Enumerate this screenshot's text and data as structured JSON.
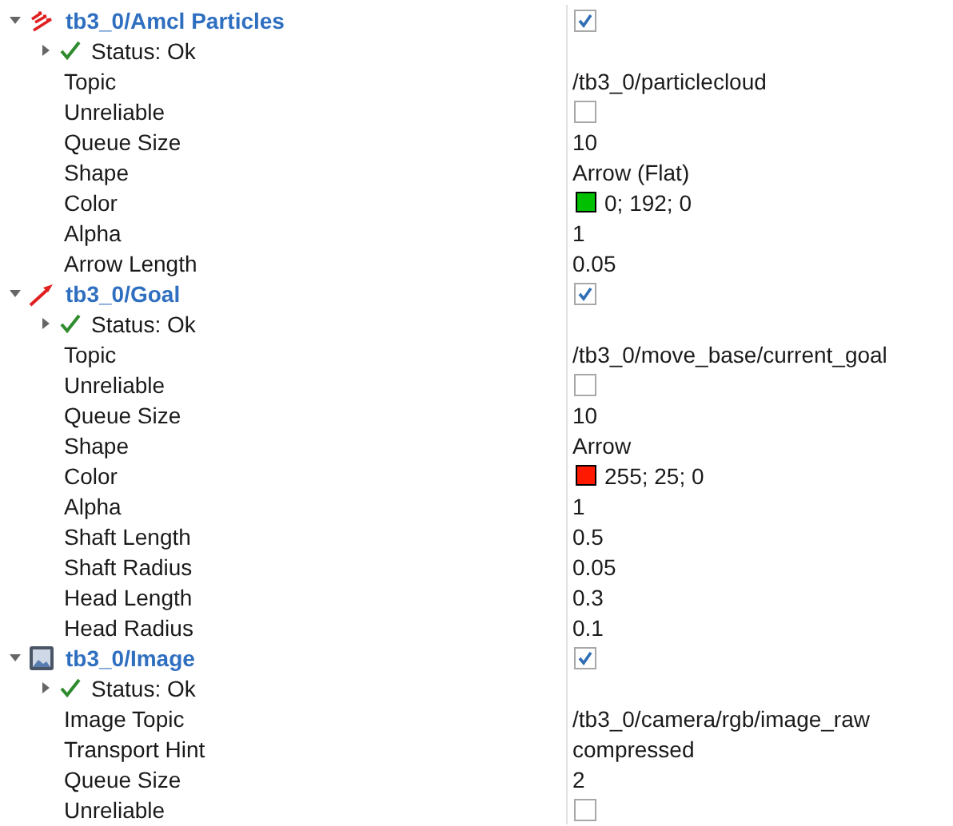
{
  "displays": [
    {
      "name": "tb3_0/Amcl Particles",
      "kind": "particles",
      "expanded": true,
      "enabled": true,
      "status": {
        "text": "Status: Ok",
        "expanded": false
      },
      "properties": [
        {
          "label": "Topic",
          "kind": "text",
          "value": "/tb3_0/particlecloud"
        },
        {
          "label": "Unreliable",
          "kind": "checkbox",
          "checked": false
        },
        {
          "label": "Queue Size",
          "kind": "text",
          "value": "10"
        },
        {
          "label": "Shape",
          "kind": "text",
          "value": "Arrow (Flat)"
        },
        {
          "label": "Color",
          "kind": "color",
          "value": "0; 192; 0",
          "color": "#00c000"
        },
        {
          "label": "Alpha",
          "kind": "text",
          "value": "1"
        },
        {
          "label": "Arrow Length",
          "kind": "text",
          "value": "0.05"
        }
      ]
    },
    {
      "name": "tb3_0/Goal",
      "kind": "pose",
      "expanded": true,
      "enabled": true,
      "status": {
        "text": "Status: Ok",
        "expanded": false
      },
      "properties": [
        {
          "label": "Topic",
          "kind": "text",
          "value": "/tb3_0/move_base/current_goal"
        },
        {
          "label": "Unreliable",
          "kind": "checkbox",
          "checked": false
        },
        {
          "label": "Queue Size",
          "kind": "text",
          "value": "10"
        },
        {
          "label": "Shape",
          "kind": "text",
          "value": "Arrow"
        },
        {
          "label": "Color",
          "kind": "color",
          "value": "255; 25; 0",
          "color": "#ff1900"
        },
        {
          "label": "Alpha",
          "kind": "text",
          "value": "1"
        },
        {
          "label": "Shaft Length",
          "kind": "text",
          "value": "0.5"
        },
        {
          "label": "Shaft Radius",
          "kind": "text",
          "value": "0.05"
        },
        {
          "label": "Head Length",
          "kind": "text",
          "value": "0.3"
        },
        {
          "label": "Head Radius",
          "kind": "text",
          "value": "0.1"
        }
      ]
    },
    {
      "name": "tb3_0/Image",
      "kind": "image",
      "expanded": true,
      "enabled": true,
      "status": {
        "text": "Status: Ok",
        "expanded": false
      },
      "properties": [
        {
          "label": "Image Topic",
          "kind": "text",
          "value": "/tb3_0/camera/rgb/image_raw"
        },
        {
          "label": "Transport Hint",
          "kind": "text",
          "value": "compressed"
        },
        {
          "label": "Queue Size",
          "kind": "text",
          "value": "2"
        },
        {
          "label": "Unreliable",
          "kind": "checkbox",
          "checked": false
        }
      ]
    }
  ]
}
